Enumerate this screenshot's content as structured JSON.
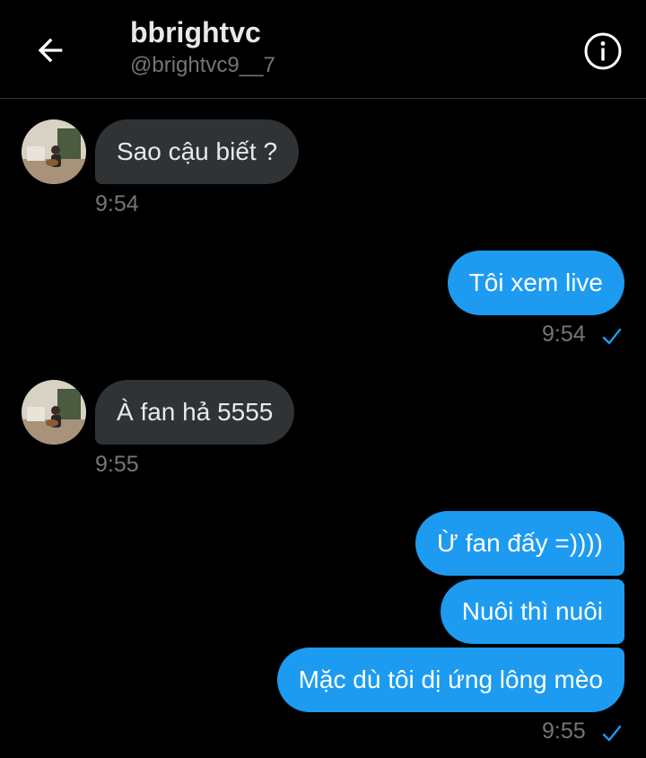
{
  "header": {
    "title": "bbrightvc",
    "handle": "@brightvc9__7",
    "back_icon": "arrow-left-icon",
    "info_icon": "info-icon"
  },
  "colors": {
    "background": "#000000",
    "incoming_bubble": "#2f3336",
    "outgoing_bubble": "#1d9bf0",
    "muted_text": "#71767b",
    "check": "#1d9bf0"
  },
  "messages": [
    {
      "direction": "incoming",
      "text": "Sao cậu biết ?",
      "time": "9:54"
    },
    {
      "direction": "outgoing",
      "text": "Tôi xem live",
      "time": "9:54",
      "status_icon": "check-icon"
    },
    {
      "direction": "incoming",
      "text": "À fan hả 5555",
      "time": "9:55"
    },
    {
      "direction": "outgoing",
      "text": "Ừ fan đấy =))))"
    },
    {
      "direction": "outgoing",
      "text": "Nuôi thì nuôi"
    },
    {
      "direction": "outgoing",
      "text": "Mặc dù tôi dị ứng lông mèo",
      "time": "9:55",
      "status_icon": "check-icon"
    }
  ]
}
